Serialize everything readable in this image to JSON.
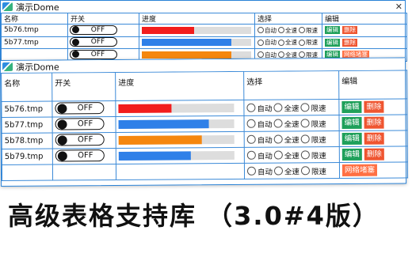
{
  "window_back": {
    "title": "演示Dome",
    "close_glyph": "✕",
    "headers": {
      "name": "名称",
      "switch": "开关",
      "progress": "进度",
      "select": "选择",
      "edit": "编辑"
    },
    "rows": [
      {
        "name": "5b76.tmp",
        "switch": "OFF",
        "progress": 0.48,
        "color": "#f21d1d",
        "opts": [
          "自动",
          "全速",
          "限速"
        ],
        "btn1": "编辑",
        "btn2": "删除"
      },
      {
        "name": "5b77.tmp",
        "switch": "OFF",
        "progress": 0.82,
        "color": "#2f80e8",
        "opts": [
          "自动",
          "全速",
          "限速"
        ],
        "btn1": "编辑",
        "btn2": "删除"
      },
      {
        "name": "",
        "switch": "OFF",
        "progress": 0.82,
        "color": "#f5870f",
        "opts": [
          "自动",
          "全速",
          "限速"
        ],
        "btn1": "编辑",
        "btn2": "网络堵塞"
      }
    ]
  },
  "window_front": {
    "title": "演示Dome",
    "headers": {
      "name": "名称",
      "switch": "开关",
      "progress": "进度",
      "select": "选择",
      "edit": "编辑"
    },
    "rows": [
      {
        "name": "5b76.tmp",
        "switch": "OFF",
        "progress": 0.46,
        "color": "#f21d1d",
        "opts": [
          "自动",
          "全速",
          "限速"
        ],
        "btn1": "编辑",
        "btn2": "删除"
      },
      {
        "name": "5b77.tmp",
        "switch": "OFF",
        "progress": 0.78,
        "color": "#2f80e8",
        "opts": [
          "自动",
          "全速",
          "限速"
        ],
        "btn1": "编辑",
        "btn2": "删除"
      },
      {
        "name": "5b78.tmp",
        "switch": "OFF",
        "progress": 0.72,
        "color": "#f5870f",
        "opts": [
          "自动",
          "全速",
          "限速"
        ],
        "btn1": "编辑",
        "btn2": "删除"
      },
      {
        "name": "5b79.tmp",
        "switch": "OFF",
        "progress": 0.62,
        "color": "#2f80e8",
        "opts": [
          "自动",
          "全速",
          "限速"
        ],
        "btn1": "编辑",
        "btn2": "删除"
      },
      {
        "name": "",
        "switch": "",
        "progress": 0.0,
        "color": "#2f80e8",
        "opts": [
          "自动",
          "全速",
          "限速"
        ],
        "btn1": "网络堵塞",
        "btn2": ""
      }
    ]
  },
  "banner": "高级表格支持库 （3.0#4版）"
}
